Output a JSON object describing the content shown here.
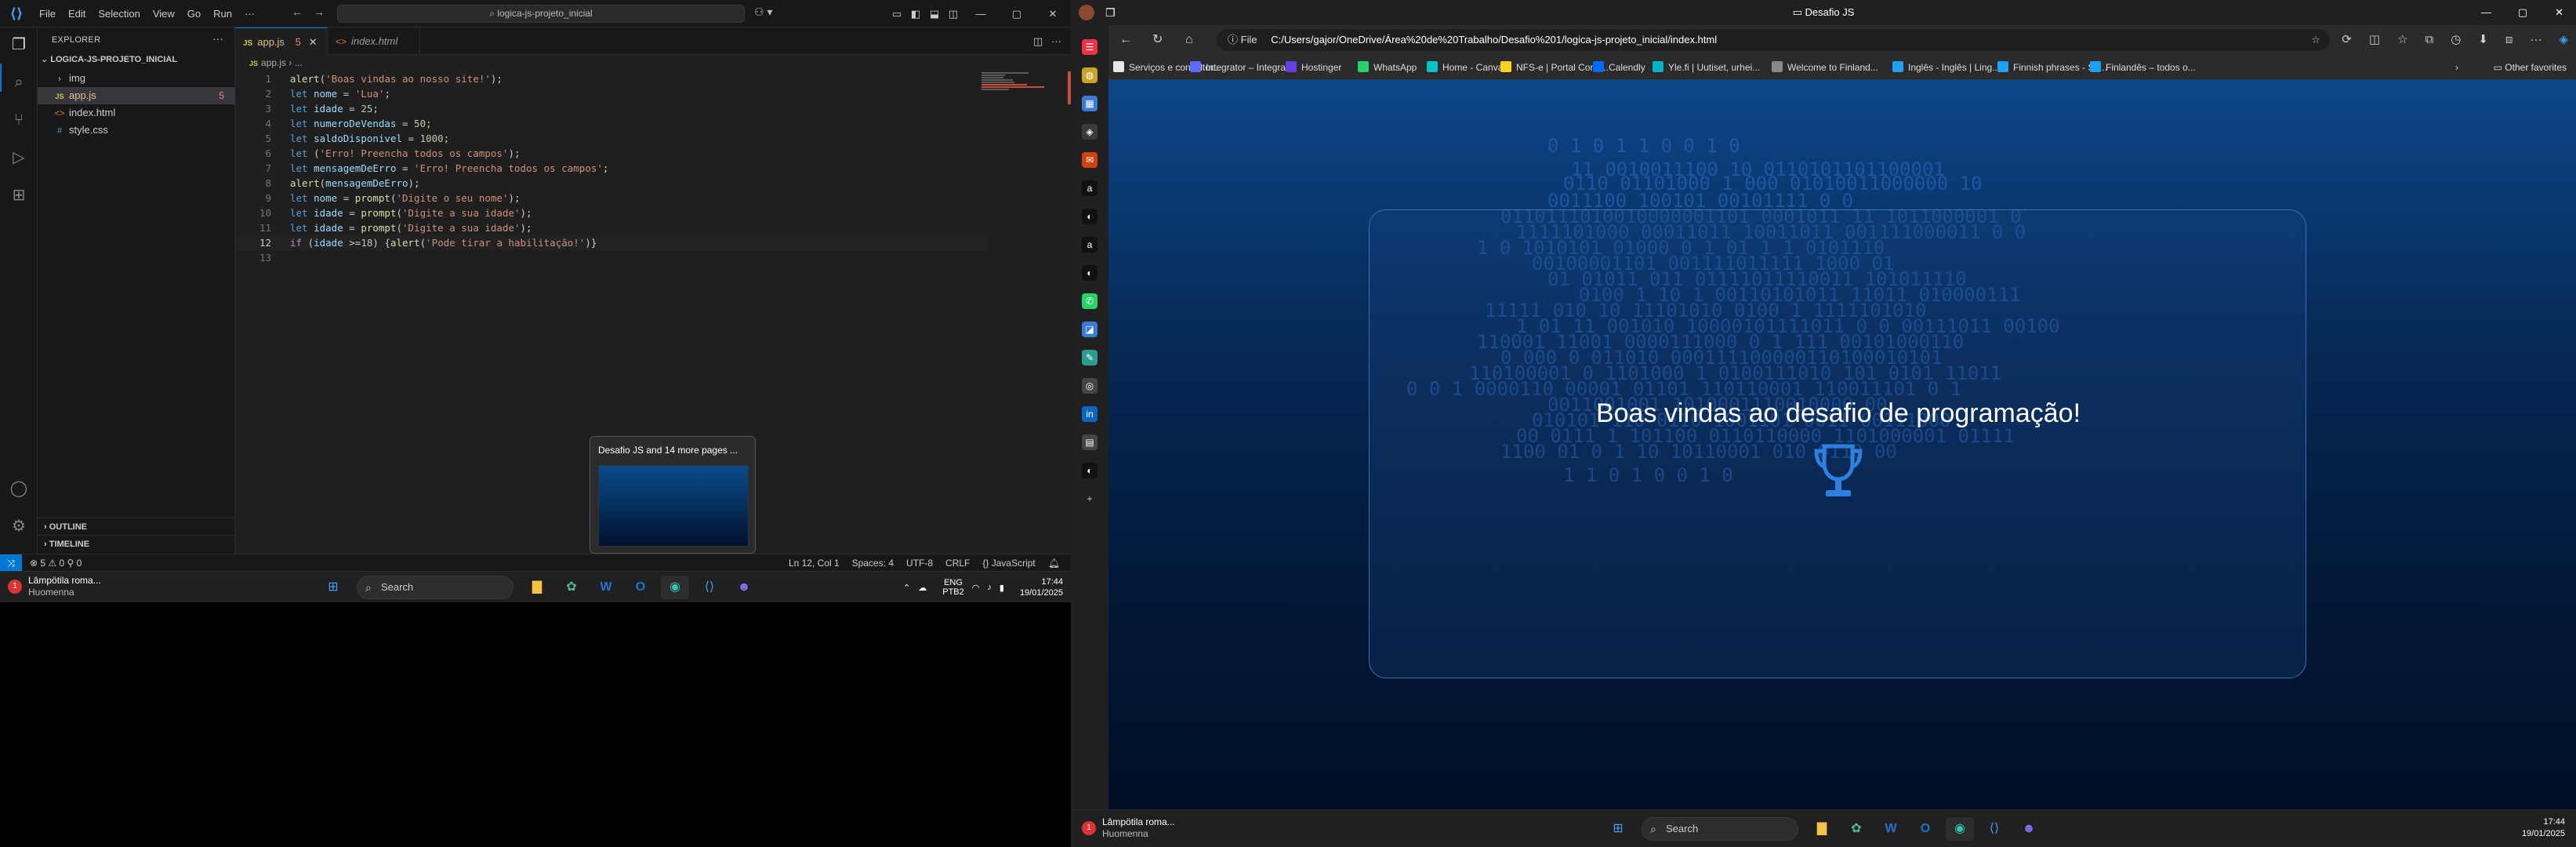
{
  "vscode": {
    "menu": [
      "File",
      "Edit",
      "Selection",
      "View",
      "Go",
      "Run",
      "···"
    ],
    "command_center": "logica-js-projeto_inicial",
    "explorer_title": "EXPLORER",
    "folder": "LOGICA-JS-PROJETO_INICIAL",
    "files": [
      {
        "name": "img",
        "kind": "folder",
        "icon": "›"
      },
      {
        "name": "app.js",
        "kind": "js",
        "icon": "JS",
        "badge": "5"
      },
      {
        "name": "index.html",
        "kind": "html",
        "icon": "<>"
      },
      {
        "name": "style.css",
        "kind": "css",
        "icon": "#"
      }
    ],
    "outline": "OUTLINE",
    "timeline": "TIMELINE",
    "tabs": [
      {
        "label": "app.js",
        "badge": "5"
      },
      {
        "label": "index.html"
      }
    ],
    "breadcrumb": "app.js › ...",
    "code": [
      [
        [
          "f",
          "alert"
        ],
        [
          "p",
          "("
        ],
        [
          "s",
          "'Boas vindas ao nosso site!'"
        ],
        [
          "p",
          ");"
        ]
      ],
      [
        [
          "k",
          "let "
        ],
        [
          "v",
          "nome"
        ],
        [
          "p",
          " = "
        ],
        [
          "s",
          "'Lua'"
        ],
        [
          "p",
          ";"
        ]
      ],
      [
        [
          "k",
          "let "
        ],
        [
          "v",
          "idade"
        ],
        [
          "p",
          " = "
        ],
        [
          "n",
          "25"
        ],
        [
          "p",
          ";"
        ]
      ],
      [
        [
          "k",
          "let "
        ],
        [
          "v",
          "numeroDeVendas"
        ],
        [
          "p",
          " = "
        ],
        [
          "n",
          "50"
        ],
        [
          "p",
          ";"
        ]
      ],
      [
        [
          "k",
          "let "
        ],
        [
          "v",
          "saldoDisponivel"
        ],
        [
          "p",
          " = "
        ],
        [
          "n",
          "1000"
        ],
        [
          "p",
          ";"
        ]
      ],
      [
        [
          "k",
          "let "
        ],
        [
          "p",
          "("
        ],
        [
          "s",
          "'Erro! Preencha todos os campos'"
        ],
        [
          "p",
          ");"
        ]
      ],
      [
        [
          "k",
          "let "
        ],
        [
          "v",
          "mensagemDeErro"
        ],
        [
          "p",
          " = "
        ],
        [
          "s",
          "'Erro! Preencha todos os campos'"
        ],
        [
          "p",
          ";"
        ]
      ],
      [
        [
          "f",
          "alert"
        ],
        [
          "p",
          "("
        ],
        [
          "v",
          "mensagemDeErro"
        ],
        [
          "p",
          ");"
        ]
      ],
      [
        [
          "k",
          "let "
        ],
        [
          "v",
          "nome"
        ],
        [
          "p",
          " = "
        ],
        [
          "f",
          "prompt"
        ],
        [
          "p",
          "("
        ],
        [
          "s",
          "'Digite o seu nome'"
        ],
        [
          "p",
          ");"
        ]
      ],
      [
        [
          "k",
          "let "
        ],
        [
          "v",
          "idade"
        ],
        [
          "p",
          " = "
        ],
        [
          "f",
          "prompt"
        ],
        [
          "p",
          "("
        ],
        [
          "s",
          "'Digite a sua idade'"
        ],
        [
          "p",
          ");"
        ]
      ],
      [
        [
          "k",
          "let "
        ],
        [
          "v",
          "idade"
        ],
        [
          "p",
          " = "
        ],
        [
          "f",
          "prompt"
        ],
        [
          "p",
          "("
        ],
        [
          "s",
          "'Digite a sua idade'"
        ],
        [
          "p",
          ");"
        ]
      ],
      [
        [
          "c",
          "if "
        ],
        [
          "p",
          "("
        ],
        [
          "v",
          "idade"
        ],
        [
          "p",
          " >="
        ],
        [
          "n",
          "18"
        ],
        [
          "p",
          ") {"
        ],
        [
          "f",
          "alert"
        ],
        [
          "p",
          "("
        ],
        [
          "s",
          "'Pode tirar a habilitação!'"
        ],
        [
          "p",
          ")}"
        ]
      ],
      []
    ],
    "status_left": "⊗ 5 ⚠ 0   ⚲ 0",
    "status_right": [
      "Ln 12, Col 1",
      "Spaces: 4",
      "UTF-8",
      "CRLF",
      "{} JavaScript"
    ],
    "thumbnail": "Desafio JS and 14 more pages ..."
  },
  "taskbar": {
    "weather_title": "Lâmpötila roma...",
    "weather_sub": "Huomenna",
    "search": "Search",
    "lang": "ENG",
    "lang2": "PTB2",
    "time": "17:44",
    "date": "19/01/2025"
  },
  "edge": {
    "title": "Desafio JS",
    "url_prefix": "File",
    "url": "C:/Users/gajor/OneDrive/Área%20de%20Trabalho/Desafio%201/logica-js-projeto_inicial/index.html",
    "favorites": [
      {
        "label": "Serviços e consultor...",
        "color": "#e8e8e8"
      },
      {
        "label": "Integrator – Integra...",
        "color": "#5b6bff"
      },
      {
        "label": "Hostinger",
        "color": "#673de6"
      },
      {
        "label": "WhatsApp",
        "color": "#25d366"
      },
      {
        "label": "Home - Canva",
        "color": "#00c4cc"
      },
      {
        "label": "NFS-e | Portal Contr...",
        "color": "#ffd21f"
      },
      {
        "label": "Calendly",
        "color": "#006bff"
      },
      {
        "label": "Yle.fi | Uutiset, urhei...",
        "color": "#00b4c8"
      },
      {
        "label": "Welcome to Finland...",
        "color": "#888888"
      },
      {
        "label": "Inglês - Inglês | Ling...",
        "color": "#1da1f2"
      },
      {
        "label": "Finnish phrases - Su...",
        "color": "#1da1f2"
      },
      {
        "label": "Finlandês – todos o...",
        "color": "#1da1f2"
      }
    ],
    "other_favorites": "Other favorites",
    "page_heading": "Boas vindas ao desafio de programação!"
  }
}
